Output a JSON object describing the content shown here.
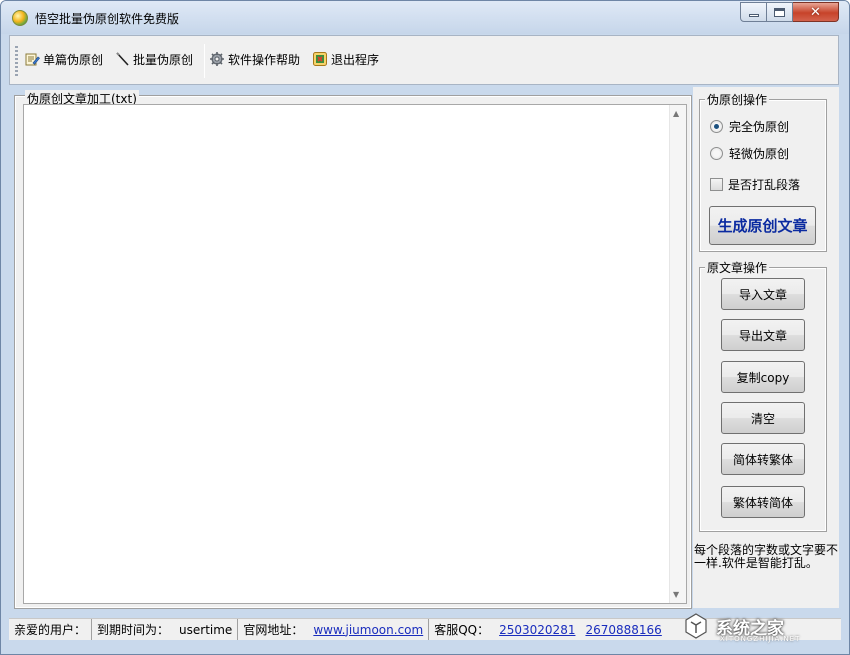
{
  "window": {
    "title": "悟空批量伪原创软件免费版"
  },
  "toolbar": {
    "items": [
      {
        "label": "单篇伪原创",
        "icon": "single-article-icon"
      },
      {
        "label": "批量伪原创",
        "icon": "batch-wand-icon"
      },
      {
        "label": "软件操作帮助",
        "icon": "gear-icon"
      },
      {
        "label": "退出程序",
        "icon": "exit-icon"
      }
    ]
  },
  "main": {
    "group_title": "伪原创文章加工(txt)",
    "editor_value": ""
  },
  "pseudo_panel": {
    "title": "伪原创操作",
    "radio_full": "完全伪原创",
    "radio_light": "轻微伪原创",
    "selected": "完全伪原创",
    "shuffle_label": "是否打乱段落",
    "shuffle_checked": false,
    "generate_button": "生成原创文章"
  },
  "original_panel": {
    "title": "原文章操作",
    "buttons": [
      "导入文章",
      "导出文章",
      "复制copy",
      "清空",
      "简体转繁体",
      "繁体转简体"
    ]
  },
  "hint_text": "每个段落的字数或文字要不一样.软件是智能打乱。",
  "statusbar": {
    "user_label": "亲爱的用户：",
    "expire_label": "到期时间为：",
    "expire_value": "usertime",
    "site_label": "官网地址：",
    "site_link": "www.jiumoon.com",
    "qq_label": "客服QQ：",
    "qq_1": "2503020281",
    "qq_2": "2670888166"
  },
  "watermark": {
    "text": "系统之家",
    "sub": "XITONGZHIJIA.NET"
  },
  "colors": {
    "link": "#1a2dbd",
    "generate_text": "#0a2aa0",
    "close_button": "#c7432a"
  }
}
